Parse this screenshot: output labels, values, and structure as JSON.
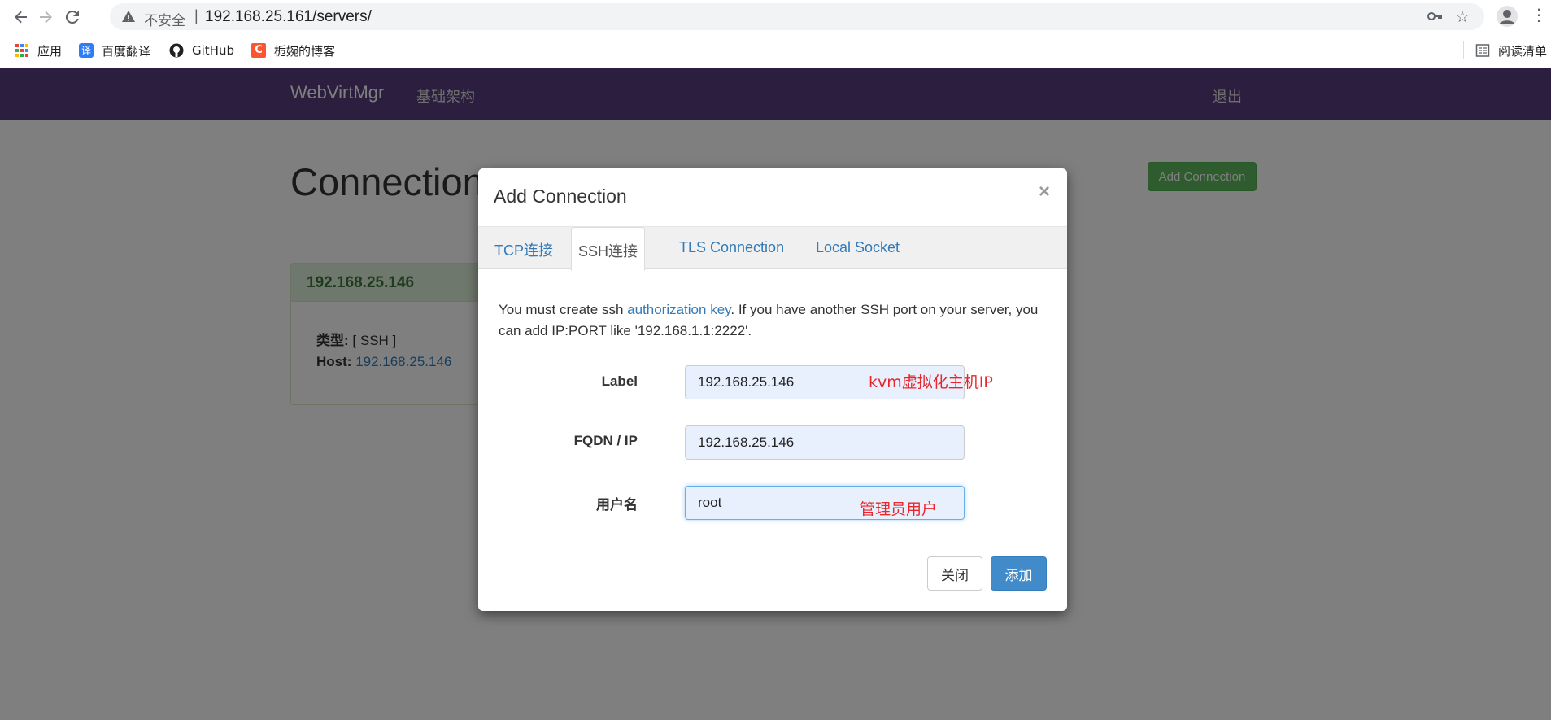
{
  "browser": {
    "insecure_label": "不安全",
    "url": "192.168.25.161/servers/",
    "bookmarks": [
      "应用",
      "百度翻译",
      "GitHub",
      "栀婉的博客"
    ],
    "reading_list": "阅读清单"
  },
  "app": {
    "brand": "WebVirtMgr",
    "nav_infrastructure": "基础架构",
    "nav_logout": "退出",
    "page_heading": "Connections",
    "add_connection_button": "Add Connection",
    "host_card": {
      "title": "192.168.25.146",
      "type_label": "类型:",
      "type_value": "[ SSH ]",
      "host_label": "Host:",
      "host_value": "192.168.25.146"
    }
  },
  "modal": {
    "title": "Add Connection",
    "close_symbol": "×",
    "tabs": [
      {
        "label": "TCP连接",
        "active": false
      },
      {
        "label": "SSH连接",
        "active": true
      },
      {
        "label": "TLS Connection",
        "active": false
      },
      {
        "label": "Local Socket",
        "active": false
      }
    ],
    "info_before_link": "You must create ssh ",
    "info_link": "authorization key",
    "info_after_link": ". If you have another SSH port on your server, you can add IP:PORT like '192.168.1.1:2222'.",
    "fields": {
      "label": {
        "label": "Label",
        "value": "192.168.25.146"
      },
      "fqdn": {
        "label": "FQDN / IP",
        "value": "192.168.25.146"
      },
      "username": {
        "label": "用户名",
        "value": "root"
      }
    },
    "annotations": {
      "label_note": "kvm虚拟化主机IP",
      "username_note": "管理员用户"
    },
    "close_button": "关闭",
    "add_button": "添加"
  }
}
